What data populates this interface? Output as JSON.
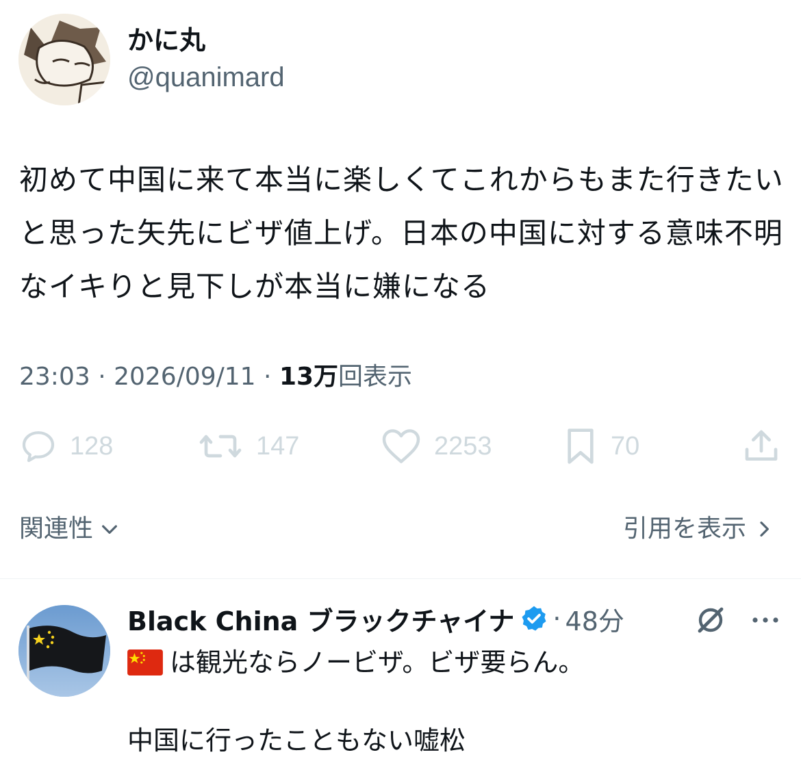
{
  "tweet": {
    "display_name": "かに丸",
    "handle": "@quanimard",
    "text": "初めて中国に来て本当に楽しくてこれからもまた行きたいと思った矢先にビザ値上げ。日本の中国に対する意味不明なイキりと見下しが本当に嫌になる",
    "time": "23:03",
    "date": "2026/09/11",
    "views_count": "13万",
    "views_label": "回表示"
  },
  "actions": {
    "replies": "128",
    "retweets": "147",
    "likes": "2253",
    "bookmarks": "70"
  },
  "sort": {
    "label": "関連性",
    "quotes_label": "引用を表示"
  },
  "reply": {
    "display_name": "Black China ブラックチャイナ",
    "time": "48分",
    "text_line1": "は観光ならノービザ。ビザ要らん。",
    "text_line2": "中国に行ったこともない嘘松"
  },
  "colors": {
    "text": "#0f1419",
    "secondary": "#536471",
    "action_icons": "#cfd9de",
    "verified": "#1d9bf0"
  },
  "icons": [
    "reply-icon",
    "retweet-icon",
    "like-icon",
    "bookmark-icon",
    "share-icon",
    "chevron-down-icon",
    "chevron-right-icon",
    "verified-badge-icon",
    "grok-icon",
    "more-icon",
    "china-flag-emoji"
  ]
}
